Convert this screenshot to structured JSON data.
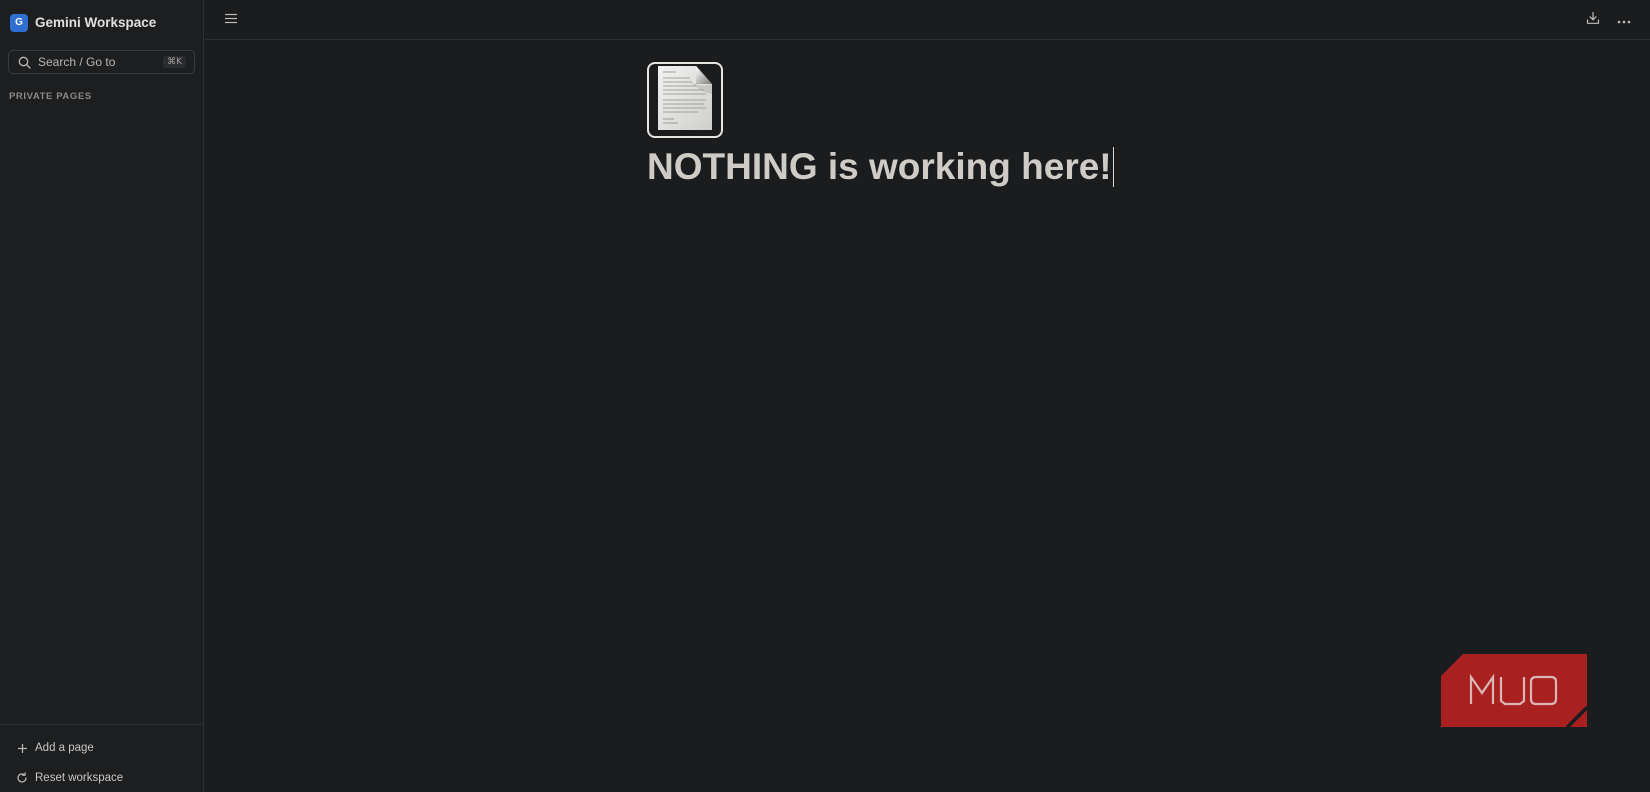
{
  "sidebar": {
    "workspace_initial": "G",
    "workspace_name": "Gemini Workspace",
    "search": {
      "placeholder": "Search / Go to",
      "shortcut": "⌘K"
    },
    "section_label": "PRIVATE PAGES",
    "footer": {
      "add_page_label": "Add a page",
      "reset_label": "Reset workspace"
    }
  },
  "topbar": {
    "left_icon": "menu-icon",
    "right_icons": [
      "download-icon",
      "more-icon"
    ]
  },
  "page": {
    "icon": "document-icon",
    "title": "NOTHING is working here!"
  },
  "watermark": {
    "text": "MUO",
    "color": "#a8201f"
  },
  "colors": {
    "background": "#1b1c1e",
    "accent": "#2f6fd2"
  }
}
